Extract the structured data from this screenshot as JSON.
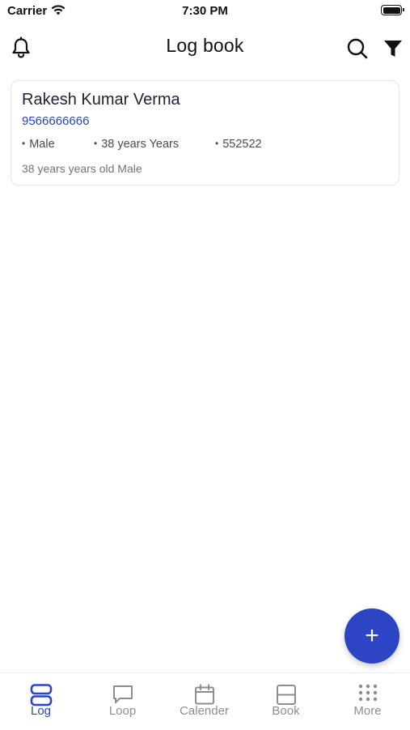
{
  "status_bar": {
    "carrier": "Carrier",
    "time": "7:30 PM"
  },
  "header": {
    "title": "Log book"
  },
  "card": {
    "name": "Rakesh Kumar Verma",
    "phone": "9566666666",
    "gender": "Male",
    "age": "38 years Years",
    "pincode": "552522",
    "summary": "38 years years old Male"
  },
  "fab": {
    "label": "+"
  },
  "bottom_nav": {
    "items": [
      {
        "label": "Log",
        "icon": "log-icon",
        "active": true
      },
      {
        "label": "Loop",
        "icon": "chat-icon",
        "active": false
      },
      {
        "label": "Calender",
        "icon": "calendar-icon",
        "active": false
      },
      {
        "label": "Book",
        "icon": "book-icon",
        "active": false
      },
      {
        "label": "More",
        "icon": "grid-icon",
        "active": false
      }
    ]
  },
  "colors": {
    "accent": "#2b45c4",
    "inactive": "#8a8d96",
    "text": "#1d2233"
  }
}
